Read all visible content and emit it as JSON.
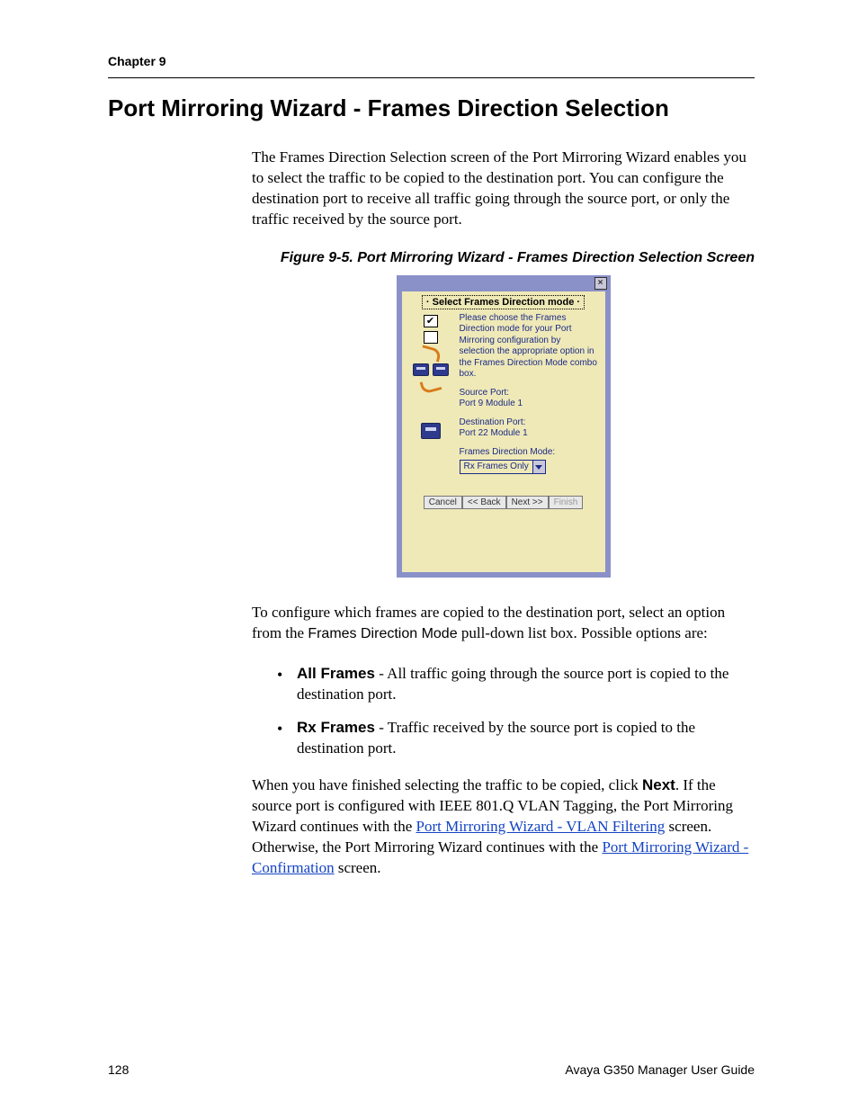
{
  "header": {
    "chapter": "Chapter 9"
  },
  "title": "Port Mirroring Wizard - Frames Direction Selection",
  "intro": "The Frames Direction Selection screen of the Port Mirroring Wizard enables you to select the traffic to be copied to the destination port. You can configure the destination port to receive all traffic going through the source port, or only the traffic received by the source port.",
  "figure": {
    "caption": "Figure 9-5.  Port Mirroring Wizard - Frames Direction Selection Screen"
  },
  "wizard": {
    "close_glyph": "×",
    "heading": "· Select Frames Direction mode ·",
    "instruction": "Please choose the Frames Direction mode for your Port Mirroring configuration by selection the appropriate option in the Frames Direction Mode combo box.",
    "source_label": "Source Port:",
    "source_value": "Port 9 Module 1",
    "dest_label": "Destination Port:",
    "dest_value": "Port 22 Module 1",
    "mode_label": "Frames Direction Mode:",
    "mode_value": "Rx Frames Only",
    "buttons": {
      "cancel": "Cancel",
      "back": "<< Back",
      "next": "Next >>",
      "finish": "Finish"
    }
  },
  "post_figure": {
    "lead_a": "To configure which frames are copied to the destination port, select an option from the ",
    "ui_term": "Frames Direction Mode",
    "lead_b": " pull-down list box. Possible options are:"
  },
  "options": [
    {
      "name": "All Frames",
      "desc": " - All traffic going through the source port is copied to the destination port."
    },
    {
      "name": "Rx Frames",
      "desc": " - Traffic received by the source port is copied to the destination port."
    }
  ],
  "closing": {
    "a": "When you have finished selecting the traffic to be copied, click ",
    "next_b": "Next",
    "b": ". If the source port is configured with IEEE 801.Q VLAN Tagging, the Port Mirroring Wizard continues with the ",
    "link1": "Port Mirroring Wizard - VLAN Filtering",
    "c": " screen. Otherwise, the Port Mirroring Wizard continues with the ",
    "link2": "Port Mirroring Wizard - Confirmation",
    "d": " screen."
  },
  "footer": {
    "page": "128",
    "doc": "Avaya G350 Manager User Guide"
  }
}
